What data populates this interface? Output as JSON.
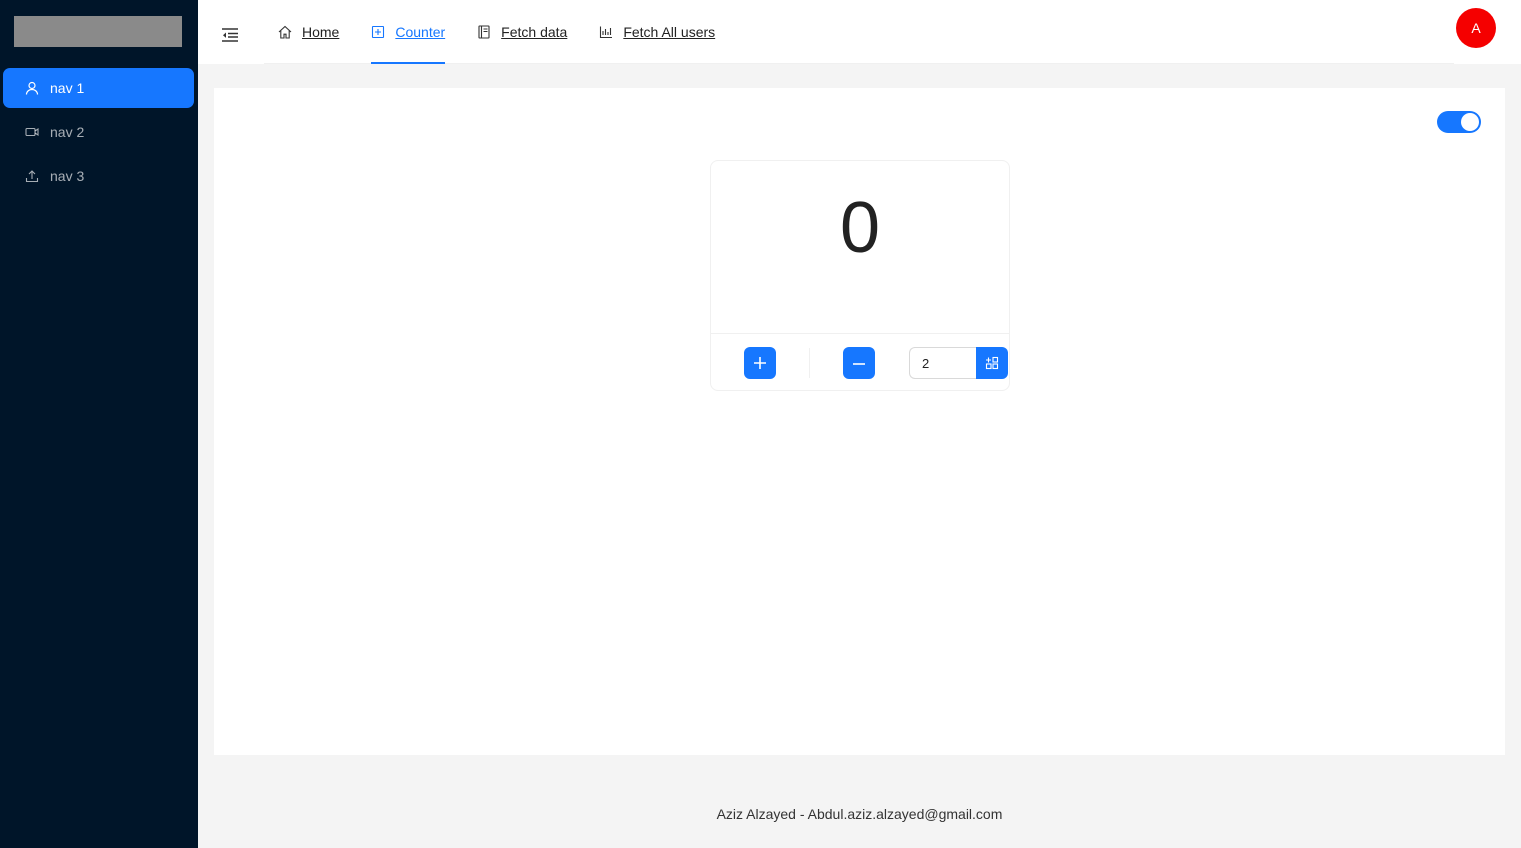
{
  "sidebar": {
    "items": [
      {
        "label": "nav 1",
        "icon": "user-icon",
        "active": true
      },
      {
        "label": "nav 2",
        "icon": "video-camera-icon",
        "active": false
      },
      {
        "label": "nav 3",
        "icon": "upload-icon",
        "active": false
      }
    ]
  },
  "header": {
    "nav": [
      {
        "label": "Home",
        "icon": "home-icon",
        "active": false
      },
      {
        "label": "Counter",
        "icon": "plus-square-icon",
        "active": true
      },
      {
        "label": "Fetch data",
        "icon": "book-icon",
        "active": false
      },
      {
        "label": "Fetch All users",
        "icon": "bar-chart-icon",
        "active": false
      }
    ],
    "avatar_letter": "A"
  },
  "counter": {
    "value": "0",
    "step_value": "2",
    "theme_toggle_on": true
  },
  "footer": {
    "text": "Aziz Alzayed - Abdul.aziz.alzayed@gmail.com"
  },
  "colors": {
    "sider_bg": "#001529",
    "primary": "#1677ff",
    "avatar_bg": "#f50000",
    "page_bg": "#f4f4f4"
  }
}
